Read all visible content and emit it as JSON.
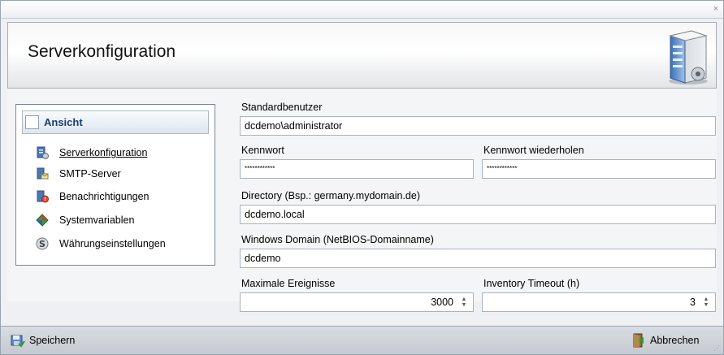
{
  "window": {
    "close_glyph": "×"
  },
  "header": {
    "title": "Serverkonfiguration",
    "icon": "server-icon"
  },
  "nav": {
    "header_label": "Ansicht",
    "items": [
      {
        "label": "Serverkonfiguration",
        "icon": "server-config-icon",
        "active": true
      },
      {
        "label": "SMTP-Server",
        "icon": "smtp-server-icon"
      },
      {
        "label": "Benachrichtigungen",
        "icon": "notifications-icon"
      },
      {
        "label": "Systemvariablen",
        "icon": "system-variables-icon"
      },
      {
        "label": "Währungseinstellungen",
        "icon": "currency-icon"
      }
    ]
  },
  "form": {
    "default_user": {
      "label": "Standardbenutzer",
      "value": "dcdemo\\administrator"
    },
    "password": {
      "label": "Kennwort",
      "value": "************"
    },
    "password_repeat": {
      "label": "Kennwort wiederholen",
      "value": "************"
    },
    "directory": {
      "label": "Directory (Bsp.: germany.mydomain.de)",
      "value": "dcdemo.local"
    },
    "windows_domain": {
      "label": "Windows Domain (NetBIOS-Domainname)",
      "value": "dcdemo"
    },
    "max_events": {
      "label": "Maximale Ereignisse",
      "value": "3000"
    },
    "inventory_timeout": {
      "label": "Inventory Timeout (h)",
      "value": "3"
    }
  },
  "statusbar": {
    "save_label": "Speichern",
    "cancel_label": "Abbrechen"
  }
}
